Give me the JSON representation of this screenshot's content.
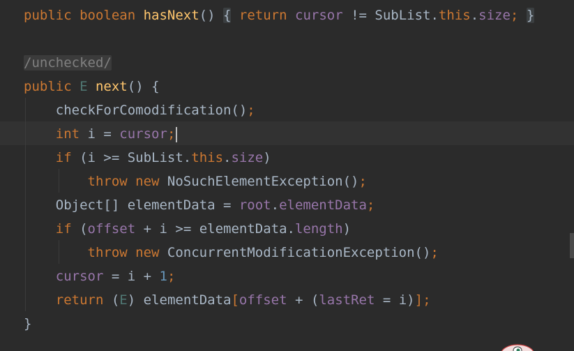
{
  "editor": {
    "lines": [
      {
        "tokens": [
          {
            "t": "public ",
            "c": "kw"
          },
          {
            "t": "boolean ",
            "c": "kw"
          },
          {
            "t": "hasNext",
            "c": "fn"
          },
          {
            "t": "()",
            "c": "plain"
          },
          {
            "t": " ",
            "c": "plain"
          },
          {
            "t": "{",
            "c": "plain brace-box"
          },
          {
            "t": " ",
            "c": "plain"
          },
          {
            "t": "return ",
            "c": "kw"
          },
          {
            "t": "cursor",
            "c": "fld"
          },
          {
            "t": " != SubList.",
            "c": "plain"
          },
          {
            "t": "this",
            "c": "kw"
          },
          {
            "t": ".",
            "c": "plain"
          },
          {
            "t": "size",
            "c": "fld"
          },
          {
            "t": ";",
            "c": "kw"
          },
          {
            "t": " ",
            "c": "plain"
          },
          {
            "t": "}",
            "c": "plain brace-box"
          }
        ]
      },
      {
        "tokens": []
      },
      {
        "tokens": [
          {
            "t": "/unchecked/",
            "c": "comment-box"
          }
        ]
      },
      {
        "tokens": [
          {
            "t": "public ",
            "c": "kw"
          },
          {
            "t": "E",
            "c": "type-param"
          },
          {
            "t": " ",
            "c": "plain"
          },
          {
            "t": "next",
            "c": "fn"
          },
          {
            "t": "() {",
            "c": "plain"
          }
        ]
      },
      {
        "tokens": [
          {
            "t": "    checkForComodification()",
            "c": "plain"
          },
          {
            "t": ";",
            "c": "kw"
          }
        ]
      },
      {
        "tokens": [
          {
            "t": "    ",
            "c": "plain"
          },
          {
            "t": "int ",
            "c": "kw"
          },
          {
            "t": "i = ",
            "c": "plain"
          },
          {
            "t": "cursor",
            "c": "fld"
          },
          {
            "t": ";",
            "c": "kw"
          }
        ],
        "caret": true
      },
      {
        "tokens": [
          {
            "t": "    ",
            "c": "plain"
          },
          {
            "t": "if ",
            "c": "kw"
          },
          {
            "t": "(i >= SubList.",
            "c": "plain"
          },
          {
            "t": "this",
            "c": "kw"
          },
          {
            "t": ".",
            "c": "plain"
          },
          {
            "t": "size",
            "c": "fld"
          },
          {
            "t": ")",
            "c": "plain"
          }
        ]
      },
      {
        "tokens": [
          {
            "t": "        ",
            "c": "plain"
          },
          {
            "t": "throw ",
            "c": "kw"
          },
          {
            "t": "new ",
            "c": "kw"
          },
          {
            "t": "NoSuchElementException()",
            "c": "plain"
          },
          {
            "t": ";",
            "c": "kw"
          }
        ]
      },
      {
        "tokens": [
          {
            "t": "    Object[] elementData = ",
            "c": "plain"
          },
          {
            "t": "root",
            "c": "fld"
          },
          {
            "t": ".",
            "c": "plain"
          },
          {
            "t": "elementData",
            "c": "fld"
          },
          {
            "t": ";",
            "c": "kw"
          }
        ]
      },
      {
        "tokens": [
          {
            "t": "    ",
            "c": "plain"
          },
          {
            "t": "if ",
            "c": "kw"
          },
          {
            "t": "(",
            "c": "plain"
          },
          {
            "t": "offset",
            "c": "fld"
          },
          {
            "t": " + i >= elementData.",
            "c": "plain"
          },
          {
            "t": "length",
            "c": "fld"
          },
          {
            "t": ")",
            "c": "plain"
          }
        ]
      },
      {
        "tokens": [
          {
            "t": "        ",
            "c": "plain"
          },
          {
            "t": "throw ",
            "c": "kw"
          },
          {
            "t": "new ",
            "c": "kw"
          },
          {
            "t": "ConcurrentModificationException()",
            "c": "plain"
          },
          {
            "t": ";",
            "c": "kw"
          }
        ]
      },
      {
        "tokens": [
          {
            "t": "    ",
            "c": "plain"
          },
          {
            "t": "cursor",
            "c": "fld"
          },
          {
            "t": " = i + ",
            "c": "plain"
          },
          {
            "t": "1",
            "c": "num"
          },
          {
            "t": ";",
            "c": "kw"
          }
        ]
      },
      {
        "tokens": [
          {
            "t": "    ",
            "c": "plain"
          },
          {
            "t": "return ",
            "c": "kw"
          },
          {
            "t": "(",
            "c": "plain"
          },
          {
            "t": "E",
            "c": "type-param"
          },
          {
            "t": ") elementData",
            "c": "plain"
          },
          {
            "t": "[",
            "c": "kw"
          },
          {
            "t": "offset",
            "c": "fld"
          },
          {
            "t": " + (",
            "c": "plain"
          },
          {
            "t": "lastRet",
            "c": "fld"
          },
          {
            "t": " = i)",
            "c": "plain"
          },
          {
            "t": "]",
            "c": "kw"
          },
          {
            "t": ";",
            "c": "kw"
          }
        ]
      },
      {
        "tokens": [
          {
            "t": "}",
            "c": "plain"
          }
        ]
      }
    ]
  },
  "colors": {
    "background": "#2b2b2b",
    "keyword": "#cc7832",
    "function": "#ffc66d",
    "field": "#9876aa",
    "number": "#6897bb",
    "text": "#a9b7c6",
    "current_line": "#323232"
  },
  "icons": {
    "mascot": "editor-mascot-icon"
  }
}
